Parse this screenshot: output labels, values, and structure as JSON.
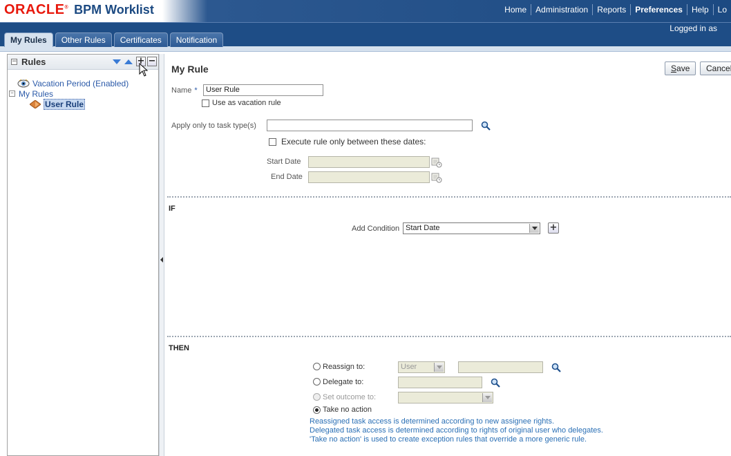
{
  "header": {
    "brand": "ORACLE",
    "app_title": "BPM Worklist",
    "nav": [
      "Home",
      "Administration",
      "Reports",
      "Preferences",
      "Help",
      "Lo"
    ],
    "logged_in_text": "Logged in as"
  },
  "tabs": [
    "My Rules",
    "Other Rules",
    "Certificates",
    "Notification"
  ],
  "rules_panel": {
    "title": "Rules",
    "tree": {
      "vacation": "Vacation Period (Enabled)",
      "my_rules": "My Rules",
      "user_rule": "User Rule"
    }
  },
  "form": {
    "title": "My Rule",
    "save_label": "Save",
    "save_mnemonic": "S",
    "save_rest": "ave",
    "cancel_label": "Cancel",
    "name_label": "Name",
    "required_marker": "*",
    "name_value": "User Rule",
    "vacation_label": "Use as vacation rule",
    "task_type_label": "Apply only to task type(s)",
    "task_type_value": "",
    "dates_label": "Execute rule only between these dates:",
    "start_date_label": "Start Date",
    "end_date_label": "End Date",
    "start_date_value": "",
    "end_date_value": ""
  },
  "if_section": {
    "title": "IF",
    "add_condition_label": "Add Condition",
    "condition_selected": "Start Date"
  },
  "then_section": {
    "title": "THEN",
    "reassign_label": "Reassign to:",
    "reassign_type": "User",
    "delegate_label": "Delegate to:",
    "set_outcome_label": "Set outcome to:",
    "no_action_label": "Take no action",
    "notes": [
      "Reassigned task access is determined according to new assignee rights.",
      "Delegated task access is determined according to rights of original user who delegates.",
      "'Take no action' is used to create exception rules that override a more generic rule."
    ]
  },
  "colors": {
    "brand_red": "#e8180c",
    "header_blue": "#1e4d86",
    "link_blue": "#2a59a8",
    "note_blue": "#2a6fb5"
  }
}
